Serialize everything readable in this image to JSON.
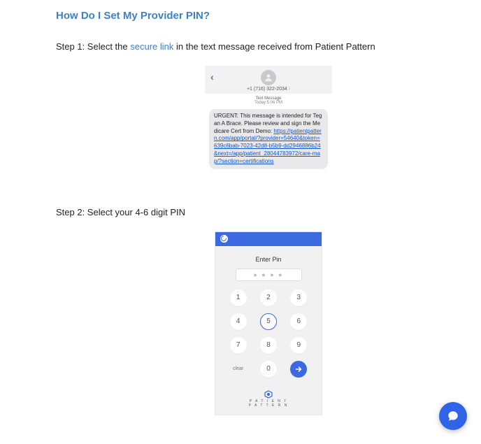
{
  "title": "How Do I Set My Provider PIN?",
  "step1": {
    "prefix": "Step 1: Select the ",
    "link": "secure link",
    "suffix": " in the text message received from Patient Pattern"
  },
  "sms": {
    "phone": "+1 (716) 322-2034",
    "meta1": "Text Message",
    "meta2": "Today 5:06 PM",
    "bodyText": "URGENT: This message is intended for Tegan A Brace. Please review and sign the Medicare Cert from Demo: ",
    "bodyLink": "https://patientpattern.com/app/portal/?provider=54640&token=639c6bab-7023-42d8-b5b9-dd2946886b24&next=/app/patient_28044783972/care-map/?section=certifications"
  },
  "step2": "Step 2: Select your 4-6 digit PIN",
  "pin": {
    "title": "Enter Pin",
    "placeholder": "● ● ● ●",
    "keys": [
      "1",
      "2",
      "3",
      "4",
      "5",
      "6",
      "7",
      "8",
      "9",
      "clear",
      "0",
      "→"
    ],
    "logoText": "P A T I E N T\nP A T T E R N"
  }
}
